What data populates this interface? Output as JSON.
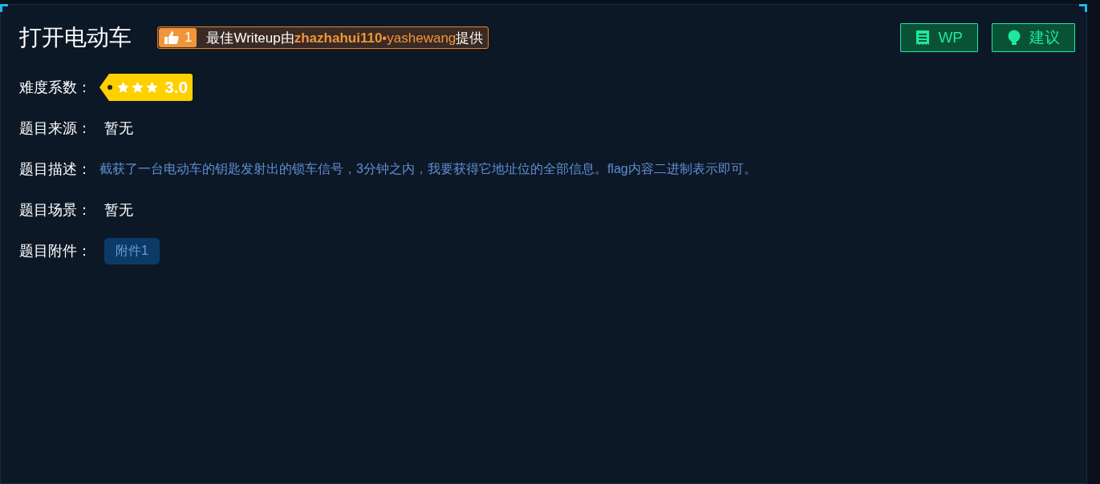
{
  "title": "打开电动车",
  "writeup": {
    "likes": "1",
    "prefix": "最佳Writeup由",
    "authors": [
      {
        "name": "zhazhahui110",
        "kind": "bold"
      },
      {
        "name": "yashewang",
        "kind": "plain"
      }
    ],
    "separator": "•",
    "suffix": "提供"
  },
  "actions": [
    {
      "label": "WP",
      "kind": "doc"
    },
    {
      "label": "建议",
      "kind": "bulb"
    }
  ],
  "fields": [
    {
      "label": "难度系数：",
      "kind": "rating",
      "stars": 3,
      "value": "3.0"
    },
    {
      "label": "题目来源：",
      "kind": "text",
      "value": "暂无"
    },
    {
      "label": "题目描述：",
      "kind": "description",
      "value": "截获了一台电动车的钥匙发射出的锁车信号，3分钟之内，我要获得它地址位的全部信息。flag内容二进制表示即可。"
    },
    {
      "label": "题目场景：",
      "kind": "text",
      "value": "暂无"
    },
    {
      "label": "题目附件：",
      "kind": "attachments",
      "files": [
        "附件1"
      ]
    }
  ]
}
